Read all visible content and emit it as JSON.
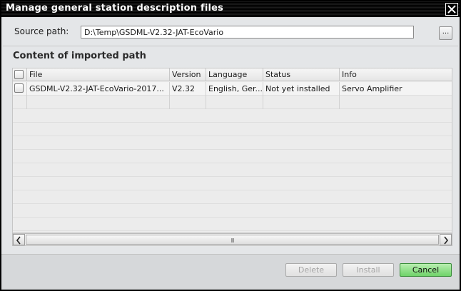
{
  "window": {
    "title": "Manage general station description files"
  },
  "source": {
    "label": "Source path:",
    "value": "D:\\Temp\\GSDML-V2.32-JAT-EcoVario",
    "browse_label": "..."
  },
  "section": {
    "title": "Content of imported path"
  },
  "table": {
    "columns": [
      "File",
      "Version",
      "Language",
      "Status",
      "Info"
    ],
    "rows": [
      {
        "file": "GSDML-V2.32-JAT-EcoVario-2017...",
        "version": "V2.32",
        "language": "English, Ger...",
        "status": "Not yet installed",
        "info": "Servo Amplifier"
      }
    ]
  },
  "scrollbar": {
    "grip": "lll"
  },
  "buttons": {
    "delete": "Delete",
    "install": "Install",
    "cancel": "Cancel"
  },
  "colors": {
    "titlebar": "#000000",
    "accent_green": "#6fd36a",
    "background": "#e4e6e8"
  }
}
